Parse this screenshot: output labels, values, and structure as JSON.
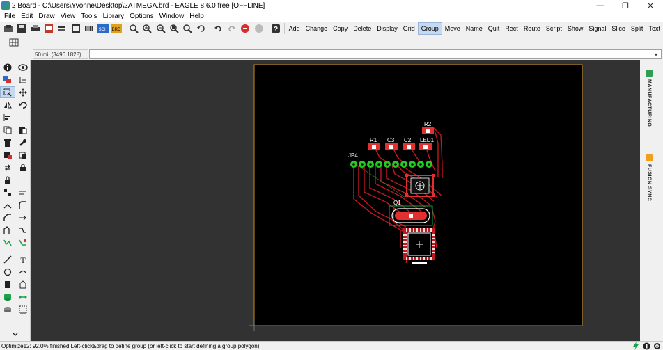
{
  "window": {
    "title": "2 Board - C:\\Users\\Yvonne\\Desktop\\2ATMEGA.brd - EAGLE 8.6.0 free [OFFLINE]",
    "minimize": "—",
    "maximize": "❐",
    "close": "✕"
  },
  "menu": [
    "File",
    "Edit",
    "Draw",
    "View",
    "Tools",
    "Library",
    "Options",
    "Window",
    "Help"
  ],
  "toolbar": {
    "commands": [
      "Add",
      "Change",
      "Copy",
      "Delete",
      "Display",
      "Grid",
      "Group",
      "Move",
      "Name",
      "Quit",
      "Rect",
      "Route",
      "Script",
      "Show",
      "Signal",
      "Slice",
      "Split",
      "Text"
    ],
    "active_command": "Group",
    "sch_label": "SCH",
    "brd_label": "BRD"
  },
  "coord": {
    "display": "50 mil (3496 1828)",
    "command_value": ""
  },
  "right_panel": {
    "tabs": [
      {
        "label": "MANUFACTURING",
        "badge_color": "#2e9e57"
      },
      {
        "label": "FUSION SYNC",
        "badge_color": "#f0a020"
      }
    ]
  },
  "board": {
    "labels": {
      "r2": "R2",
      "r1": "R1",
      "c3": "C3",
      "c2": "C2",
      "led1": "LED1",
      "jp4": "JP4",
      "q1": "Q1"
    },
    "colors": {
      "background": "#000000",
      "outline": "#c88a1a",
      "pads": "#22cc22",
      "traces": "#c0181f",
      "smd": "#e23030",
      "silkscreen": "#ffffff",
      "canvas": "#333232"
    }
  },
  "status": {
    "text": "Optimize12: 92.0% finished Left-click&drag to define group (or left-click to start defining a group polygon)"
  }
}
